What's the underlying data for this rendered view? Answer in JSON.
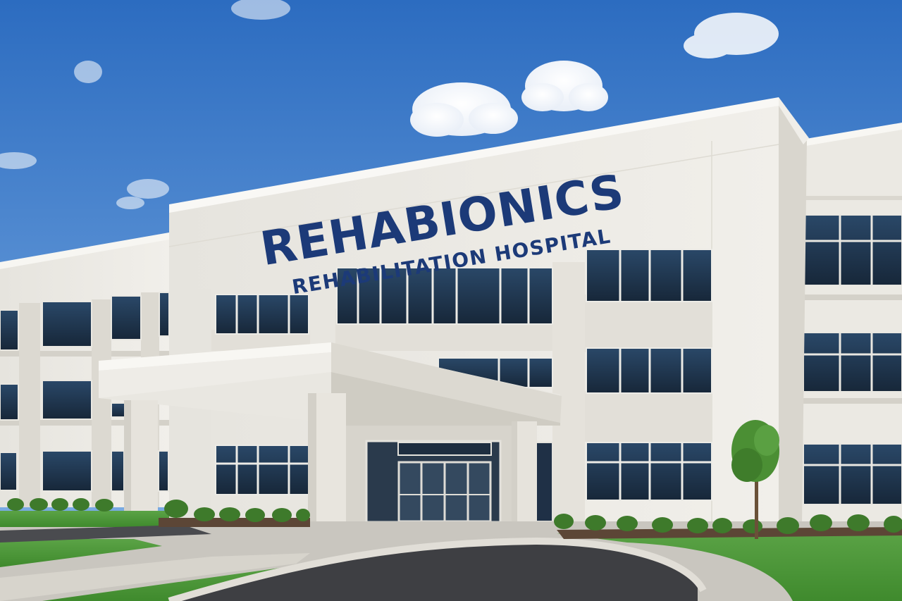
{
  "sign": {
    "name": "REHABIONICS",
    "subtitle": "REHABILITATION HOSPITAL"
  },
  "colors": {
    "sky_top": "#2f6fc2",
    "sky_bottom": "#7fb0e6",
    "facade": "#eceae4",
    "facade_shadow": "#d7d4cc",
    "sign_text": "#1c3a78",
    "window_glass": "#1f3550",
    "lawn": "#4f9a3a",
    "asphalt": "#3c3d40",
    "sidewalk": "#d9d6cf"
  },
  "icons": {
    "clouds": "cloud-icon",
    "tree": "tree-icon",
    "shrubs": "shrub-icon"
  }
}
